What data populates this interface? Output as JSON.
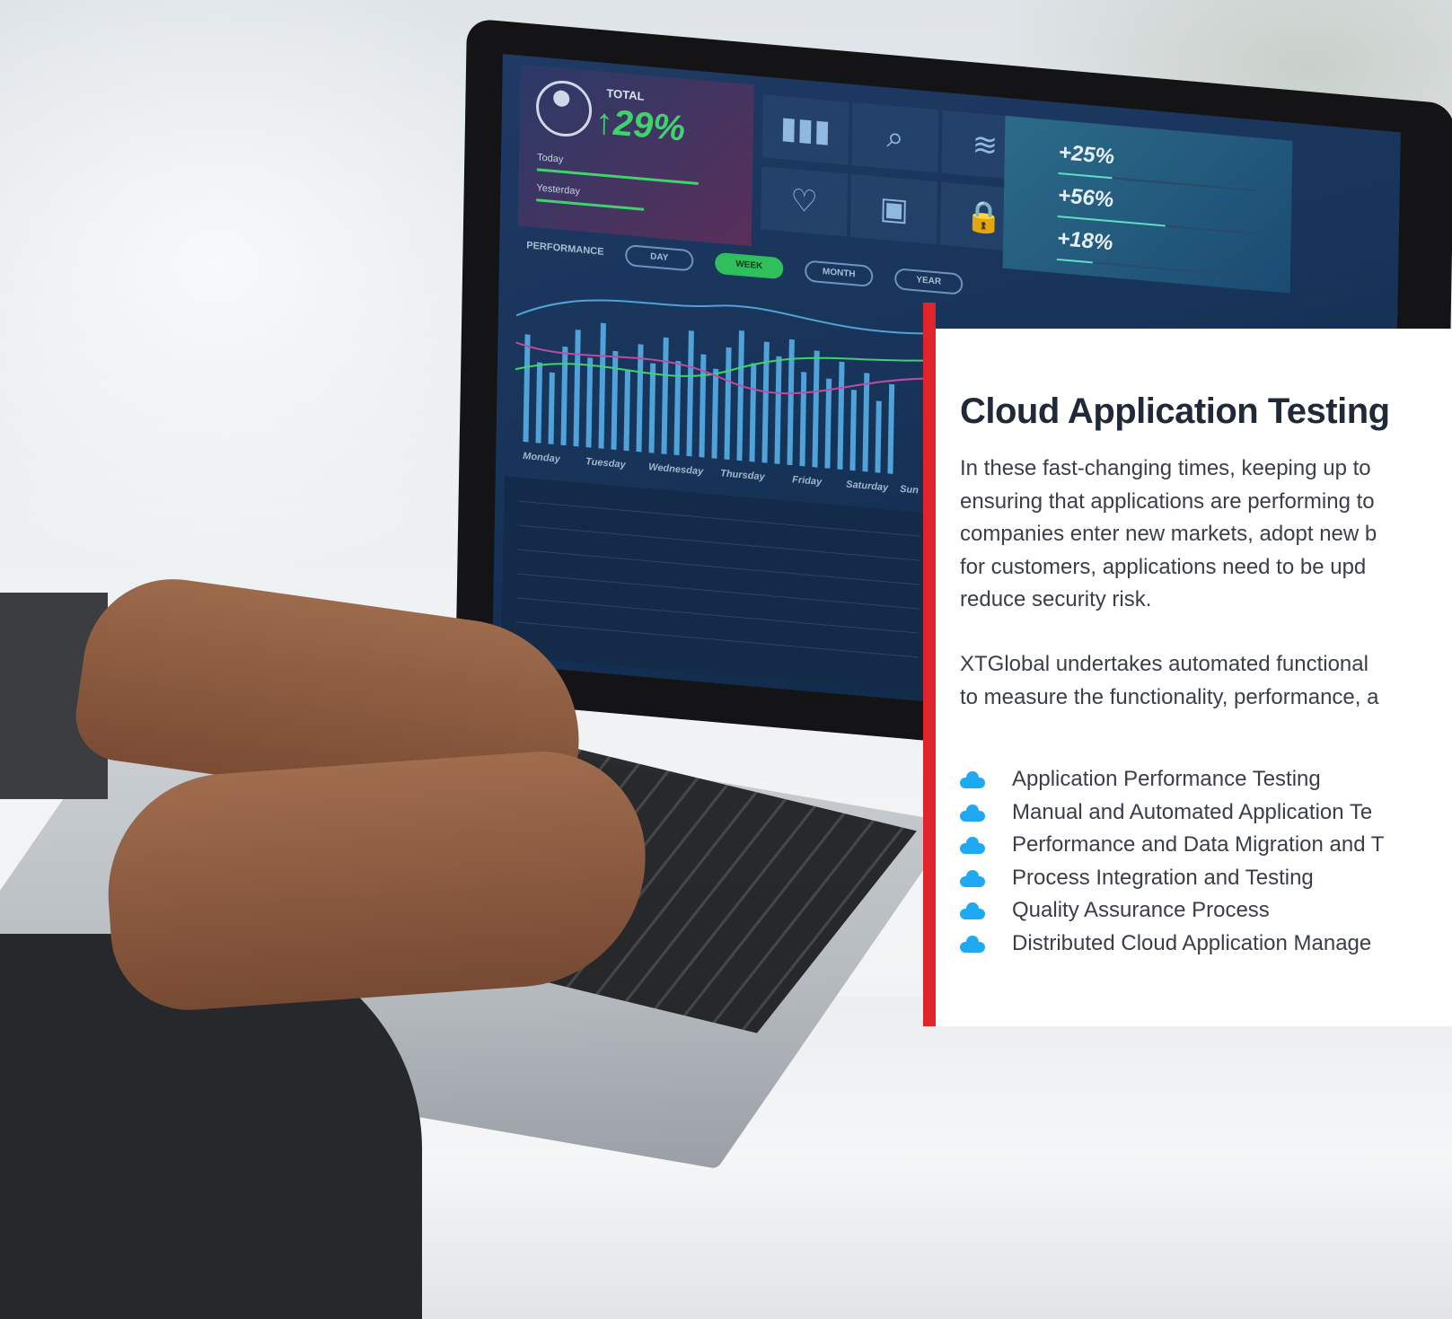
{
  "screen": {
    "total_label": "TOTAL",
    "total_value": "29%",
    "today_label": "Today",
    "yesterday_label": "Yesterday",
    "stats": [
      "+25%",
      "+56%",
      "+18%"
    ],
    "performance_label": "PERFORMANCE",
    "range_buttons": [
      "DAY",
      "WEEK",
      "MONTH",
      "YEAR"
    ],
    "day_labels": [
      "Monday",
      "Tuesday",
      "Wednesday",
      "Thursday",
      "Friday",
      "Saturday",
      "Sun"
    ],
    "icons": [
      "bar-chart-icon",
      "search-icon",
      "layers-icon",
      "heart-pulse-icon",
      "calendar-icon",
      "lock-icon"
    ]
  },
  "card": {
    "title": "Cloud Application Testing",
    "paragraph1_lines": [
      "In these fast-changing times, keeping up to",
      "ensuring that applications are performing to",
      "companies enter new markets, adopt new b",
      "for customers, applications need to be upd",
      "reduce security risk."
    ],
    "paragraph2_lines": [
      "XTGlobal undertakes automated functional",
      "to measure the functionality, performance, a"
    ],
    "list_items": [
      "Application Performance Testing",
      "Manual and Automated Application Te",
      "Performance and Data Migration and T",
      "Process Integration and Testing",
      "Quality Assurance Process",
      "Distributed Cloud Application Manage"
    ],
    "accent_color": "#e0242c",
    "bullet_color": "#1fa9f2",
    "bullet_icon": "cloud-icon"
  }
}
